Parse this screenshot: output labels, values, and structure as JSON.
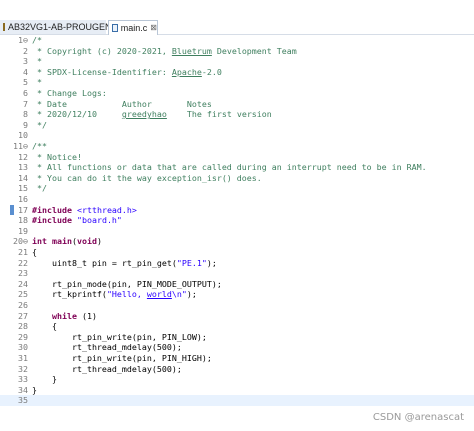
{
  "tabs": {
    "project": {
      "label": "AB32VG1-AB-PROUGEN",
      "icon": "project-folder-icon"
    },
    "file": {
      "label": "main.c",
      "icon": "c-source-file-icon",
      "close": "⊠"
    }
  },
  "editor": {
    "current_line": "35",
    "lines": [
      {
        "n": "1⊖",
        "parts": [
          [
            "comment",
            "/*"
          ]
        ]
      },
      {
        "n": "2",
        "parts": [
          [
            "comment",
            " * Copyright (c) 2020-2021, "
          ],
          [
            "comment-link",
            "Bluetrum"
          ],
          [
            "comment",
            " Development Team"
          ]
        ]
      },
      {
        "n": "3",
        "parts": [
          [
            "comment",
            " *"
          ]
        ]
      },
      {
        "n": "4",
        "parts": [
          [
            "comment",
            " * SPDX-License-Identifier: "
          ],
          [
            "comment-link",
            "Apache"
          ],
          [
            "comment",
            "-2.0"
          ]
        ]
      },
      {
        "n": "5",
        "parts": [
          [
            "comment",
            " *"
          ]
        ]
      },
      {
        "n": "6",
        "parts": [
          [
            "comment",
            " * Change Logs:"
          ]
        ]
      },
      {
        "n": "7",
        "parts": [
          [
            "comment",
            " * Date           Author       Notes"
          ]
        ]
      },
      {
        "n": "8",
        "parts": [
          [
            "comment",
            " * 2020/12/10     "
          ],
          [
            "comment-link",
            "greedyhao"
          ],
          [
            "comment",
            "    The first version"
          ]
        ]
      },
      {
        "n": "9",
        "parts": [
          [
            "comment",
            " */"
          ]
        ]
      },
      {
        "n": "10",
        "parts": []
      },
      {
        "n": "11⊖",
        "parts": [
          [
            "comment",
            "/**"
          ]
        ]
      },
      {
        "n": "12",
        "parts": [
          [
            "comment",
            " * Notice!"
          ]
        ]
      },
      {
        "n": "13",
        "parts": [
          [
            "comment",
            " * All functions or data that are called during an interrupt need to be in RAM."
          ]
        ]
      },
      {
        "n": "14",
        "parts": [
          [
            "comment",
            " * You can do it the way exception_isr() does."
          ]
        ]
      },
      {
        "n": "15",
        "parts": [
          [
            "comment",
            " */"
          ]
        ]
      },
      {
        "n": "16",
        "parts": []
      },
      {
        "n": "17",
        "parts": [
          [
            "pp",
            "#include "
          ],
          [
            "str",
            "<rtthread.h>"
          ]
        ]
      },
      {
        "n": "18",
        "parts": [
          [
            "pp",
            "#include "
          ],
          [
            "str",
            "\"board.h\""
          ]
        ]
      },
      {
        "n": "19",
        "parts": []
      },
      {
        "n": "20⊖",
        "parts": [
          [
            "kw",
            "int "
          ],
          [
            "kw",
            "main"
          ],
          [
            "plain",
            "("
          ],
          [
            "kw",
            "void"
          ],
          [
            "plain",
            ")"
          ]
        ]
      },
      {
        "n": "21",
        "parts": [
          [
            "plain",
            "{"
          ]
        ]
      },
      {
        "n": "22",
        "parts": [
          [
            "plain",
            "    uint8_t pin = rt_pin_get("
          ],
          [
            "str",
            "\"PE.1\""
          ],
          [
            "plain",
            ");"
          ]
        ]
      },
      {
        "n": "23",
        "parts": []
      },
      {
        "n": "24",
        "parts": [
          [
            "plain",
            "    rt_pin_mode(pin, PIN_MODE_OUTPUT);"
          ]
        ]
      },
      {
        "n": "25",
        "parts": [
          [
            "plain",
            "    rt_kprintf("
          ],
          [
            "str",
            "\"Hello, "
          ],
          [
            "str-link",
            "world"
          ],
          [
            "str",
            "\\n\""
          ],
          [
            "plain",
            ");"
          ]
        ]
      },
      {
        "n": "26",
        "parts": []
      },
      {
        "n": "27",
        "parts": [
          [
            "kw",
            "    while "
          ],
          [
            "plain",
            "(1)"
          ]
        ]
      },
      {
        "n": "28",
        "parts": [
          [
            "plain",
            "    {"
          ]
        ]
      },
      {
        "n": "29",
        "parts": [
          [
            "plain",
            "        rt_pin_write(pin, PIN_LOW);"
          ]
        ]
      },
      {
        "n": "30",
        "parts": [
          [
            "plain",
            "        rt_thread_mdelay(500);"
          ]
        ]
      },
      {
        "n": "31",
        "parts": [
          [
            "plain",
            "        rt_pin_write(pin, PIN_HIGH);"
          ]
        ]
      },
      {
        "n": "32",
        "parts": [
          [
            "plain",
            "        rt_thread_mdelay(500);"
          ]
        ]
      },
      {
        "n": "33",
        "parts": [
          [
            "plain",
            "    }"
          ]
        ]
      },
      {
        "n": "34",
        "parts": [
          [
            "plain",
            "}"
          ]
        ]
      },
      {
        "n": "35",
        "parts": []
      }
    ]
  },
  "watermark": "CSDN @arenascat",
  "colors": {
    "comment": "#3f7f5f",
    "keyword": "#7f0055",
    "string": "#2a00ff",
    "current_line": "#e8f2fe"
  }
}
